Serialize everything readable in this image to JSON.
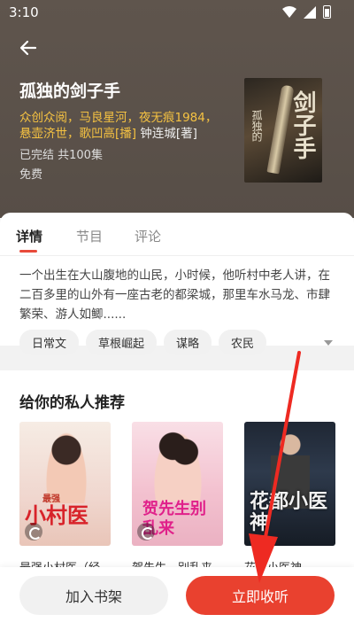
{
  "status_bar": {
    "time": "3:10"
  },
  "book": {
    "title": "孤独的剑子手",
    "narrators": "众创众阅，马良星河，夜无痕1984，悬壶济世，歌凹高[播]",
    "author": "钟连城[著]",
    "status": "已完结  共100集",
    "price": "免费",
    "cover_title": "剑子手",
    "cover_subtitle": "孤独的"
  },
  "tabs": [
    {
      "label": "详情"
    },
    {
      "label": "节目"
    },
    {
      "label": "评论"
    }
  ],
  "synopsis": "一个出生在大山腹地的山民，小时候，他听村中老人讲，在二百多里的山外有一座古老的都梁城，那里车水马龙、市肆繁荣、游人如鲫......",
  "tags": [
    "日常文",
    "草根崛起",
    "谋略",
    "农民"
  ],
  "recommend": {
    "title": "给你的私人推荐",
    "items": [
      {
        "cover_title": "小村医",
        "cover_sub": "最强",
        "name": "最强小村医（经"
      },
      {
        "cover_title": "贺先生别乱来",
        "name": "贺先生，别乱来"
      },
      {
        "cover_title": "花都小医神",
        "name": "花都小医神"
      }
    ]
  },
  "buttons": {
    "add_shelf": "加入书架",
    "listen_now": "立即收听"
  },
  "colors": {
    "accent": "#e9412f",
    "header_bg": "#5a514a",
    "narrator_gold": "#f5c242"
  }
}
